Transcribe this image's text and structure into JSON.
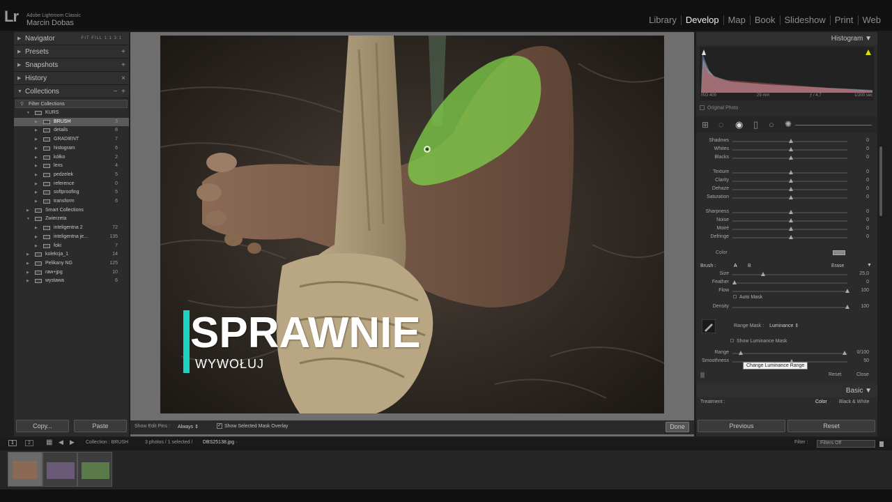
{
  "app": {
    "logo": "Lr",
    "name": "Adobe Lightroom Classic",
    "user": "Marcin Dobas"
  },
  "modules": [
    "Library",
    "Develop",
    "Map",
    "Book",
    "Slideshow",
    "Print",
    "Web"
  ],
  "active_module": "Develop",
  "left_panel": {
    "navigator": "Navigator",
    "navigator_opts": "FIT  FILL  1:1  3:1",
    "presets": "Presets",
    "snapshots": "Snapshots",
    "history": "History",
    "collections": "Collections",
    "filter": "Filter Collections",
    "rows": [
      {
        "label": "KURS",
        "count": "",
        "indent": 1,
        "open": true
      },
      {
        "label": "BRUSH",
        "count": "3",
        "indent": 2,
        "selected": true
      },
      {
        "label": "details",
        "count": "8",
        "indent": 2
      },
      {
        "label": "GRADIENT",
        "count": "7",
        "indent": 2
      },
      {
        "label": "histogram",
        "count": "6",
        "indent": 2
      },
      {
        "label": "kółko",
        "count": "2",
        "indent": 2
      },
      {
        "label": "lens",
        "count": "4",
        "indent": 2
      },
      {
        "label": "pedzelek",
        "count": "5",
        "indent": 2
      },
      {
        "label": "reference",
        "count": "0",
        "indent": 2
      },
      {
        "label": "softproofing",
        "count": "5",
        "indent": 2
      },
      {
        "label": "transform",
        "count": "6",
        "indent": 2
      },
      {
        "label": "Smart Collections",
        "count": "",
        "indent": 1
      },
      {
        "label": "Zwierzeta",
        "count": "",
        "indent": 1,
        "open": true
      },
      {
        "label": "inteligentna 2",
        "count": "72",
        "indent": 2
      },
      {
        "label": "inteligentna je...",
        "count": "135",
        "indent": 2
      },
      {
        "label": "foki",
        "count": "7",
        "indent": 2
      },
      {
        "label": "kolekcja_1",
        "count": "14",
        "indent": 1
      },
      {
        "label": "Pelikany NG",
        "count": "125",
        "indent": 1
      },
      {
        "label": "raw+jpg",
        "count": "10",
        "indent": 1
      },
      {
        "label": "wystawa",
        "count": "6",
        "indent": 1
      }
    ],
    "copy": "Copy...",
    "paste": "Paste"
  },
  "toolbar": {
    "show_pins": "Show Edit Pins :",
    "always": "Always ⇕",
    "check": "✓",
    "overlay": "Show Selected Mask Overlay",
    "done": "Done"
  },
  "overlay": {
    "title": "SPRAWNIE",
    "subtitle": "WYWOŁUJ"
  },
  "right_panel": {
    "histogram": "Histogram ▼",
    "meta": {
      "iso": "ISO 400",
      "focal": "29 mm",
      "aperture": "ƒ / 4,7",
      "shutter": "1/200 sec"
    },
    "original_photo": "Original Photo",
    "sliders": [
      {
        "label": "Shadows",
        "value": "0",
        "pos": 0.5
      },
      {
        "label": "Whites",
        "value": "0",
        "pos": 0.5
      },
      {
        "label": "Blacks",
        "value": "0",
        "pos": 0.5
      },
      {
        "label": "Texture",
        "value": "0",
        "pos": 0.5
      },
      {
        "label": "Clarity",
        "value": "0",
        "pos": 0.5
      },
      {
        "label": "Dehaze",
        "value": "0",
        "pos": 0.5
      },
      {
        "label": "Saturation",
        "value": "0",
        "pos": 0.5
      },
      {
        "label": "Sharpness",
        "value": "0",
        "pos": 0.5
      },
      {
        "label": "Noise",
        "value": "0",
        "pos": 0.5
      },
      {
        "label": "Moiré",
        "value": "0",
        "pos": 0.5
      },
      {
        "label": "Defringe",
        "value": "0",
        "pos": 0.5
      }
    ],
    "color": "Color",
    "brush": {
      "label": "Brush :",
      "a": "A",
      "b": "B",
      "erase": "Erase"
    },
    "brush_sliders": [
      {
        "label": "Size",
        "value": "25,0",
        "pos": 0.25
      },
      {
        "label": "Feather",
        "value": "0",
        "pos": 0.0
      },
      {
        "label": "Flow",
        "value": "100",
        "pos": 1.0
      },
      {
        "label": "Density",
        "value": "100",
        "pos": 1.0
      }
    ],
    "auto_mask": "Auto Mask",
    "range_mask": "Range Mask :",
    "range_mask_value": "Luminance ⇕",
    "show_lum": "Show Luminance Mask",
    "range_label": "Range",
    "range_value": "0/100",
    "smooth_label": "Smoothness",
    "smooth_value": "50",
    "tooltip": "Change Luminance Range",
    "reset": "Reset",
    "close": "Close",
    "basic": "Basic ▼",
    "treatment": "Treatment :",
    "treat_color": "Color",
    "treat_bw": "Black & White",
    "previous": "Previous",
    "reset_btn": "Reset"
  },
  "filmstrip": {
    "one": "1",
    "two": "2",
    "collection": "Collection : BRUSH",
    "info": "3 photos / 1 selected /",
    "file": "DBS25138.jpg ·",
    "filter": "Filter :",
    "filter_value": "Filters Off"
  }
}
